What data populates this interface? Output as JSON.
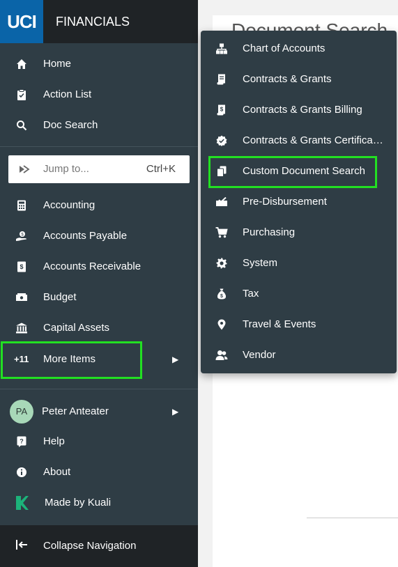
{
  "brand": {
    "logo_text": "UCI",
    "title": "FINANCIALS"
  },
  "sidebar": {
    "top_items": [
      {
        "label": "Home",
        "icon": "home-icon"
      },
      {
        "label": "Action List",
        "icon": "clipboard-check-icon"
      },
      {
        "label": "Doc Search",
        "icon": "search-icon"
      }
    ],
    "jump": {
      "placeholder": "Jump to...",
      "shortcut": "Ctrl+K",
      "icon": "jump-icon"
    },
    "module_items": [
      {
        "label": "Accounting",
        "icon": "calculator-icon"
      },
      {
        "label": "Accounts Payable",
        "icon": "hand-coin-icon"
      },
      {
        "label": "Accounts Receivable",
        "icon": "receipt-dollar-icon"
      },
      {
        "label": "Budget",
        "icon": "money-icon"
      },
      {
        "label": "Capital Assets",
        "icon": "bank-icon"
      }
    ],
    "more_items": {
      "badge": "+11",
      "label": "More Items"
    },
    "user": {
      "initials": "PA",
      "name": "Peter Anteater"
    },
    "bottom_items": [
      {
        "label": "Help",
        "icon": "help-icon"
      },
      {
        "label": "About",
        "icon": "info-icon"
      },
      {
        "label": "Made by Kuali",
        "icon": "kuali-logo-icon"
      }
    ],
    "collapse": {
      "label": "Collapse Navigation",
      "icon": "collapse-arrow-icon"
    }
  },
  "content": {
    "title": "Document Search"
  },
  "flyout": {
    "items": [
      {
        "label": "Chart of Accounts",
        "icon": "sitemap-icon"
      },
      {
        "label": "Contracts & Grants",
        "icon": "document-scroll-icon"
      },
      {
        "label": "Contracts & Grants Billing",
        "icon": "document-dollar-icon"
      },
      {
        "label": "Contracts & Grants Certifica…",
        "icon": "certificate-icon"
      },
      {
        "label": "Custom Document Search",
        "icon": "documents-icon"
      },
      {
        "label": "Pre-Disbursement",
        "icon": "checkbook-icon"
      },
      {
        "label": "Purchasing",
        "icon": "cart-icon"
      },
      {
        "label": "System",
        "icon": "gear-icon"
      },
      {
        "label": "Tax",
        "icon": "money-bag-icon"
      },
      {
        "label": "Travel & Events",
        "icon": "map-pin-icon"
      },
      {
        "label": "Vendor",
        "icon": "users-icon"
      }
    ]
  },
  "colors": {
    "sidebar_bg": "#2f3d45",
    "brand_bar_bg": "#1f2326",
    "logo_blue": "#0a64a8",
    "highlight_green": "#22e022",
    "avatar_green": "#a8d8b8",
    "kuali_green": "#1cb37a"
  }
}
